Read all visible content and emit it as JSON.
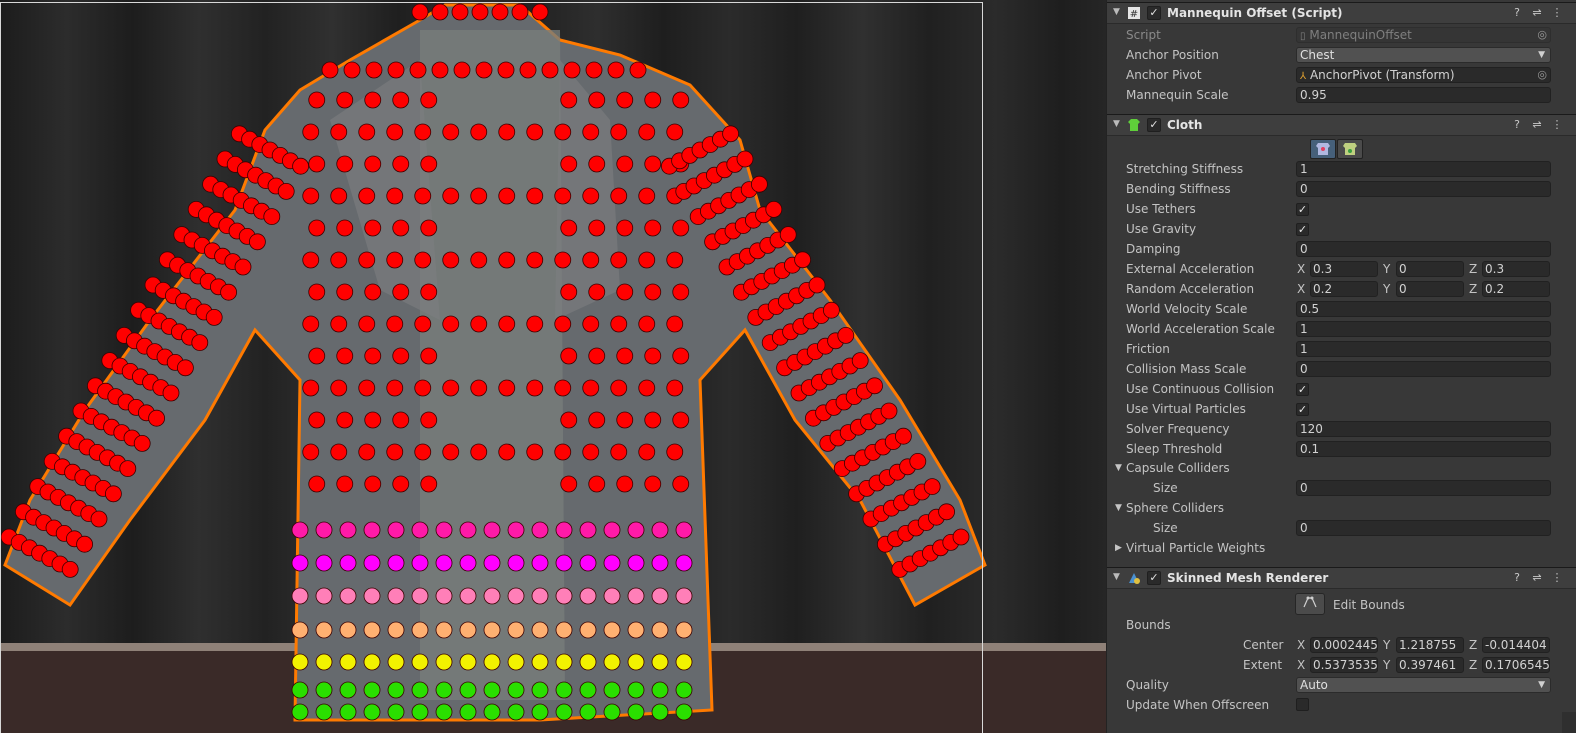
{
  "mannequin_offset": {
    "title": "Mannequin Offset (Script)",
    "script_label": "Script",
    "script_value": "MannequinOffset",
    "anchor_position_label": "Anchor Position",
    "anchor_position_value": "Chest",
    "anchor_pivot_label": "Anchor Pivot",
    "anchor_pivot_value": "AnchorPivot (Transform)",
    "mannequin_scale_label": "Mannequin Scale",
    "mannequin_scale_value": "0.95"
  },
  "cloth": {
    "title": "Cloth",
    "props": [
      {
        "label": "Stretching Stiffness",
        "value": "1"
      },
      {
        "label": "Bending Stiffness",
        "value": "0"
      },
      {
        "label": "Use Tethers",
        "checked": true
      },
      {
        "label": "Use Gravity",
        "checked": true
      },
      {
        "label": "Damping",
        "value": "0"
      },
      {
        "label": "External Acceleration",
        "x": "0.3",
        "y": "0",
        "z": "0.3"
      },
      {
        "label": "Random Acceleration",
        "x": "0.2",
        "y": "0",
        "z": "0.2"
      },
      {
        "label": "World Velocity Scale",
        "value": "0.5"
      },
      {
        "label": "World Acceleration Scale",
        "value": "1"
      },
      {
        "label": "Friction",
        "value": "1"
      },
      {
        "label": "Collision Mass Scale",
        "value": "0"
      },
      {
        "label": "Use Continuous Collision",
        "checked": true
      },
      {
        "label": "Use Virtual Particles",
        "checked": true
      },
      {
        "label": "Solver Frequency",
        "value": "120"
      },
      {
        "label": "Sleep Threshold",
        "value": "0.1"
      }
    ],
    "capsule_colliders_label": "Capsule Colliders",
    "capsule_size_label": "Size",
    "capsule_size_value": "0",
    "sphere_colliders_label": "Sphere Colliders",
    "sphere_size_label": "Size",
    "sphere_size_value": "0",
    "virtual_particle_weights_label": "Virtual Particle Weights"
  },
  "skinned_mesh_renderer": {
    "title": "Skinned Mesh Renderer",
    "edit_bounds_label": "Edit Bounds",
    "bounds_label": "Bounds",
    "center_label": "Center",
    "center": {
      "x": "0.0002445",
      "y": "1.218755",
      "z": "-0.014404"
    },
    "extent_label": "Extent",
    "extent": {
      "x": "0.5373535",
      "y": "0.397461",
      "z": "0.1706545"
    },
    "quality_label": "Quality",
    "quality_value": "Auto",
    "update_offscreen_label": "Update When Offscreen",
    "update_offscreen_checked": false
  },
  "axis_letters": {
    "x": "X",
    "y": "Y",
    "z": "Z"
  },
  "colors": {
    "particle_red": "#ff0000",
    "particle_pink": "#ff1aa8",
    "particle_magenta": "#ff00ff",
    "particle_lightpink": "#ff7fb8",
    "particle_peach": "#ffb071",
    "particle_yellow": "#f2f200",
    "particle_green": "#2adf00",
    "outline_orange": "#ff7a00"
  },
  "icons": [
    "fold-arrow-icon",
    "script-icon",
    "help-icon",
    "preset-icon",
    "menu-icon",
    "cloth-icon",
    "skinned-mesh-icon",
    "edit-bounds-icon"
  ]
}
